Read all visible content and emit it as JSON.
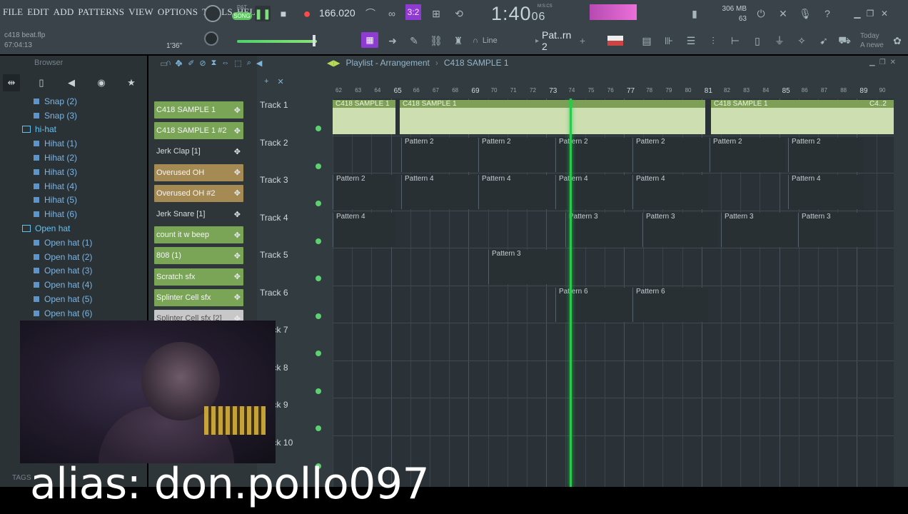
{
  "menu": [
    "FILE",
    "EDIT",
    "ADD",
    "PATTERNS",
    "VIEW",
    "OPTIONS",
    "TOOLS",
    "HELP"
  ],
  "transport": {
    "pat_label": "PAT",
    "song_label": "SONG",
    "tempo": "166.020",
    "time": "1:40",
    "time_fraction": "06",
    "time_label": "M:S:CS"
  },
  "system": {
    "memory": "306 MB",
    "cpu": "63"
  },
  "project": {
    "file_name": "c418 beat.flp",
    "elapsed": "67:04:13",
    "song_position": "1'36\""
  },
  "toolbar": {
    "snap_label": "Line",
    "pattern_label": "Pat..rn 2",
    "news_line1": "Today",
    "news_line2": "A newe"
  },
  "browser": {
    "title": "Browser",
    "tree": [
      {
        "label": "Snap  (2)",
        "type": "leaf"
      },
      {
        "label": "Snap  (3)",
        "type": "leaf"
      },
      {
        "label": "hi-hat",
        "type": "folder"
      },
      {
        "label": "Hihat (1)",
        "type": "leaf"
      },
      {
        "label": "Hihat (2)",
        "type": "leaf"
      },
      {
        "label": "Hihat (3)",
        "type": "leaf"
      },
      {
        "label": "Hihat (4)",
        "type": "leaf"
      },
      {
        "label": "Hihat (5)",
        "type": "leaf"
      },
      {
        "label": "Hihat (6)",
        "type": "leaf"
      },
      {
        "label": "Open hat",
        "type": "folder"
      },
      {
        "label": "Open hat (1)",
        "type": "leaf"
      },
      {
        "label": "Open hat (2)",
        "type": "leaf"
      },
      {
        "label": "Open hat (3)",
        "type": "leaf"
      },
      {
        "label": "Open hat (4)",
        "type": "leaf"
      },
      {
        "label": "Open hat (5)",
        "type": "leaf"
      },
      {
        "label": "Open hat (6)",
        "type": "leaf"
      }
    ],
    "tags_label": "TAGS"
  },
  "channels": [
    {
      "label": "C418 SAMPLE 1",
      "style": "green"
    },
    {
      "label": "C418 SAMPLE 1 #2",
      "style": "green"
    },
    {
      "label": "Jerk Clap [1]",
      "style": "plain"
    },
    {
      "label": "Overused OH",
      "style": "tan"
    },
    {
      "label": "Overused OH  #2",
      "style": "tan"
    },
    {
      "label": "Jerk Snare [1]",
      "style": "plain"
    },
    {
      "label": "count it w beep",
      "style": "green"
    },
    {
      "label": "808 (1)",
      "style": "green"
    },
    {
      "label": "Scratch sfx",
      "style": "green"
    },
    {
      "label": "Splinter Cell sfx",
      "style": "green"
    },
    {
      "label": "Splinter Cell sfx [2]",
      "style": "dim"
    }
  ],
  "playlist": {
    "title": "Playlist - Arrangement",
    "pattern": "C418 SAMPLE 1",
    "bars": [
      "62",
      "63",
      "64",
      "65",
      "66",
      "67",
      "68",
      "69",
      "70",
      "71",
      "72",
      "73",
      "74",
      "75",
      "76",
      "77",
      "78",
      "79",
      "80",
      "81",
      "82",
      "83",
      "84",
      "85",
      "86",
      "87",
      "88",
      "89",
      "90"
    ],
    "tracks": [
      "Track 1",
      "Track 2",
      "Track 3",
      "Track 4",
      "Track 5",
      "Track 6",
      "Track 7",
      "Track 8",
      "Track 9",
      "Track 10"
    ],
    "clips": {
      "track1": [
        "C418 SAMPLE 1",
        "C418 SAMPLE 1",
        "C418 SAMPLE 1",
        "C4..2"
      ],
      "track2": [
        "Pattern 2",
        "Pattern 2",
        "Pattern 2",
        "Pattern 2",
        "Pattern 2",
        "Pattern 2"
      ],
      "track3": [
        "Pattern 2",
        "Pattern 4",
        "Pattern 4",
        "Pattern 4",
        "Pattern 4",
        "Pattern 4"
      ],
      "track4": [
        "Pattern 4",
        "Pattern 3",
        "Pattern 3",
        "Pattern 3",
        "Pattern 3"
      ],
      "track5": [
        "Pattern 3"
      ],
      "track6": [
        "Pattern 6",
        "Pattern 6"
      ]
    }
  },
  "caption": "alias: don.pollo097"
}
